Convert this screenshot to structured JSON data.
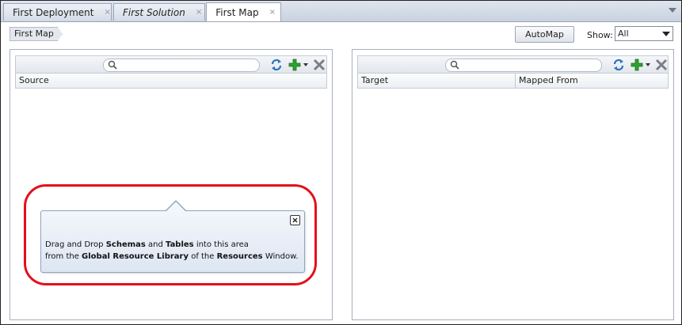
{
  "tabs": [
    {
      "label": "First Deployment",
      "icon": "deployment-icon",
      "active": false,
      "italic": false
    },
    {
      "label": "First Solution",
      "icon": "puzzle-icon",
      "active": false,
      "italic": true
    },
    {
      "label": "First Map",
      "icon": "map-icon",
      "active": true,
      "italic": false
    }
  ],
  "tab_close_glyph": "×",
  "breadcrumb": "First Map",
  "toolbar": {
    "automap_label": "AutoMap",
    "show_label": "Show:",
    "show_value": "All"
  },
  "source_panel": {
    "columns": [
      "Source"
    ],
    "search_placeholder": ""
  },
  "target_panel": {
    "columns": [
      "Target",
      "Mapped From"
    ],
    "search_placeholder": ""
  },
  "callout": {
    "line1": {
      "t1": "Drag and Drop ",
      "b1": "Schemas",
      "t2": " and ",
      "b2": "Tables",
      "t3": " into this area"
    },
    "line2": {
      "t1": "from the ",
      "b1": "Global Resource Library",
      "t2": " of the ",
      "b2": "Resources",
      "t3": " Window."
    }
  },
  "colors": {
    "highlight": "#e3101a",
    "add_green": "#2ea12e",
    "refresh_blue": "#2b6fc4"
  }
}
